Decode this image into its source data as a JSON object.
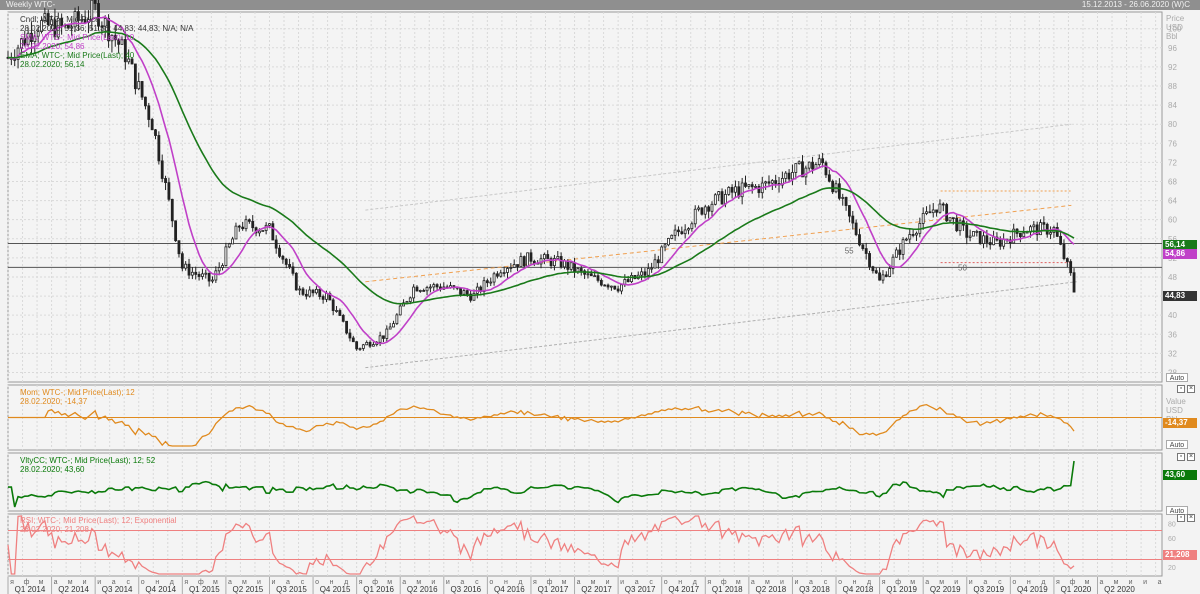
{
  "window": {
    "title": "Weekly WTC-",
    "range": "15.12.2013 - 26.06.2020 (W)C"
  },
  "colors": {
    "price": "#222222",
    "sma": "#c040c8",
    "ema": "#1a7a1a",
    "mom": "#e08a1e",
    "vlty": "#0a7a0a",
    "rsi": "#ef8080",
    "trend_orange": "#f0a050",
    "trend_gray": "#b0b0b0"
  },
  "main_panel": {
    "legend": [
      {
        "label": "Cndl; WTC-; Mid Price",
        "value": "28.02.2020; 51,36; 51,36; 44,83; 44,83; N/A; N/A",
        "color": "#333333"
      },
      {
        "label": "SMA; WTC-; Mid Price(Last); 10",
        "value": "28.02.2020; 54,86",
        "color": "#c040c8"
      },
      {
        "label": "EMA; WTC-; Mid Price(Last); 40",
        "value": "28.02.2020; 56,14",
        "color": "#1a7a1a"
      }
    ],
    "axis_title": [
      "Price",
      "USD",
      "Bbl"
    ],
    "y_ticks": [
      "100",
      "96",
      "92",
      "88",
      "84",
      "80",
      "76",
      "72",
      "68",
      "64",
      "60",
      "56",
      "52",
      "48",
      "44",
      "40",
      "36",
      "32",
      "28"
    ],
    "level_labels": [
      "55",
      "50"
    ],
    "badges": [
      {
        "text": "56,14",
        "color": "#1a7a1a"
      },
      {
        "text": "54,86",
        "color": "#c040c8"
      },
      {
        "text": "44,83",
        "color": "#333333"
      }
    ],
    "auto": "Auto"
  },
  "mom_panel": {
    "legend": "Mom; WTC-; Mid Price(Last); 12",
    "value": "28.02.2020; -14,37",
    "axis_title": [
      "Value",
      "USD",
      "Bbl"
    ],
    "badge": "-14,37",
    "auto": "Auto"
  },
  "vlty_panel": {
    "legend": "VltyCC; WTC-; Mid Price(Last); 12; 52",
    "value": "28.02.2020; 43,60",
    "badge": "43,60",
    "auto": "Auto"
  },
  "rsi_panel": {
    "legend": "RSI; WTC-; Mid Price(Last); 12; Exponential",
    "value": "28.02.2020; 21,208",
    "y_ticks": [
      "80",
      "60",
      "40",
      "20"
    ],
    "badge": "21,208",
    "auto": "Auto"
  },
  "x_axis": {
    "months": [
      "я",
      "ф",
      "м",
      "а",
      "м",
      "и",
      "и",
      "а",
      "с",
      "о",
      "н",
      "д",
      "я",
      "ф",
      "м",
      "а",
      "м",
      "и",
      "и",
      "а",
      "с",
      "о",
      "н",
      "д",
      "я",
      "ф",
      "м",
      "а",
      "м",
      "и",
      "и",
      "а",
      "с",
      "о",
      "н",
      "д",
      "я",
      "ф",
      "м",
      "а",
      "м",
      "и",
      "и",
      "а",
      "с",
      "о",
      "н",
      "д",
      "я",
      "ф",
      "м",
      "а",
      "м",
      "и",
      "и",
      "а",
      "с",
      "о",
      "н",
      "д",
      "я",
      "ф",
      "м",
      "а",
      "м",
      "и",
      "и",
      "а",
      "с",
      "о",
      "н",
      "д",
      "я",
      "ф",
      "м",
      "а",
      "м",
      "и",
      "и",
      "а",
      "с",
      "о",
      "н",
      "д",
      "я",
      "ф",
      "м",
      "а",
      "м",
      "и"
    ],
    "quarters": [
      "Q1 2014",
      "Q2 2014",
      "Q3 2014",
      "Q4 2014",
      "Q1 2015",
      "Q2 2015",
      "Q3 2015",
      "Q4 2015",
      "Q1 2016",
      "Q2 2016",
      "Q3 2016",
      "Q4 2016",
      "Q1 2017",
      "Q2 2017",
      "Q3 2017",
      "Q4 2017",
      "Q1 2018",
      "Q2 2018",
      "Q3 2018",
      "Q4 2018",
      "Q1 2019",
      "Q2 2019",
      "Q3 2019",
      "Q4 2019",
      "Q1 2020",
      "Q2 2020"
    ]
  },
  "chart_data": {
    "type": "line",
    "title": "Weekly WTC-",
    "x_range": [
      "2014-01",
      "2020-06"
    ],
    "ylabel": "Price USD Bbl",
    "ylim": [
      28,
      100
    ],
    "approx_close_monthly": [
      [
        2014.0,
        94
      ],
      [
        2014.17,
        101
      ],
      [
        2014.33,
        100
      ],
      [
        2014.5,
        104
      ],
      [
        2014.67,
        95
      ],
      [
        2014.83,
        80
      ],
      [
        2015.0,
        50
      ],
      [
        2015.17,
        47
      ],
      [
        2015.33,
        59
      ],
      [
        2015.5,
        58
      ],
      [
        2015.67,
        45
      ],
      [
        2015.83,
        44
      ],
      [
        2016.0,
        33
      ],
      [
        2016.17,
        36
      ],
      [
        2016.33,
        46
      ],
      [
        2016.5,
        46
      ],
      [
        2016.67,
        44
      ],
      [
        2016.83,
        50
      ],
      [
        2017.0,
        52
      ],
      [
        2017.17,
        51
      ],
      [
        2017.33,
        48
      ],
      [
        2017.5,
        46
      ],
      [
        2017.67,
        49
      ],
      [
        2017.83,
        57
      ],
      [
        2018.0,
        63
      ],
      [
        2018.17,
        66
      ],
      [
        2018.33,
        67
      ],
      [
        2018.5,
        70
      ],
      [
        2018.67,
        72
      ],
      [
        2018.83,
        60
      ],
      [
        2019.0,
        47
      ],
      [
        2019.17,
        57
      ],
      [
        2019.33,
        63
      ],
      [
        2019.5,
        57
      ],
      [
        2019.67,
        55
      ],
      [
        2019.83,
        58
      ],
      [
        2020.0,
        58
      ],
      [
        2020.13,
        44.83
      ]
    ],
    "last_values": {
      "close": 44.83,
      "sma10": 54.86,
      "ema40": 56.14,
      "mom12": -14.37,
      "vlty": 43.6,
      "rsi12": 21.208
    },
    "series": [
      {
        "name": "Cndl; WTC-; Mid Price"
      },
      {
        "name": "SMA; WTC-; Mid Price(Last); 10"
      },
      {
        "name": "EMA; WTC-; Mid Price(Last); 40"
      },
      {
        "name": "Mom; WTC-; Mid Price(Last); 12"
      },
      {
        "name": "VltyCC; WTC-; Mid Price(Last); 12; 52"
      },
      {
        "name": "RSI; WTC-; Mid Price(Last); 12; Exponential"
      }
    ],
    "horizontal_levels": [
      55,
      50
    ],
    "grid": true,
    "legend_position": "top-left"
  }
}
